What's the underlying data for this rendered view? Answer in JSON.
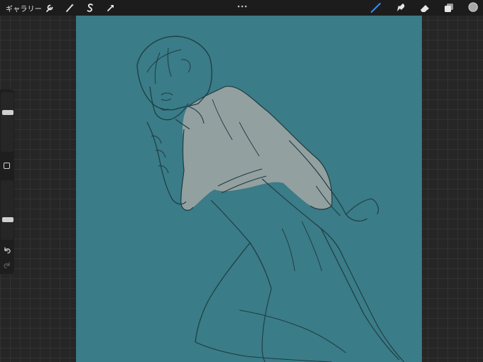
{
  "topbar": {
    "gallery_label": "ギャラリー",
    "left_tools": [
      "wrench-icon",
      "magic-wand-icon",
      "selection-s-icon",
      "arrow-transform-icon"
    ],
    "right_tools": [
      "brush-icon",
      "smudge-icon",
      "eraser-icon",
      "layers-icon",
      "color-icon"
    ]
  },
  "colors": {
    "canvas": "#3a7c87",
    "active_tool": "#2f8cff",
    "current_color": "#a8a8a8",
    "sketch_line": "#1f3b42"
  },
  "sidebar": {
    "brush_size_level": 0.68,
    "opacity_level": 0.32,
    "undo_icon": "undo-icon",
    "redo_icon": "redo-icon"
  }
}
